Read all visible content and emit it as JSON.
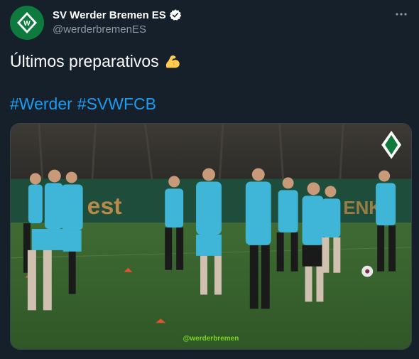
{
  "author": {
    "display_name": "SV Werder Bremen ES",
    "handle": "@werderbremenES"
  },
  "tweet": {
    "text": "Últimos preparativos",
    "emoji": "flexed-biceps",
    "hashtags": [
      "#Werder",
      "#SVWFCB"
    ]
  },
  "media": {
    "watermark": "@werderbremen",
    "banner_text": "est"
  },
  "colors": {
    "background": "#15202b",
    "link": "#1d9bf0",
    "secondary_text": "#8b98a5",
    "werder_green": "#0f7a3d",
    "kit_teal": "#3fb6d8"
  }
}
